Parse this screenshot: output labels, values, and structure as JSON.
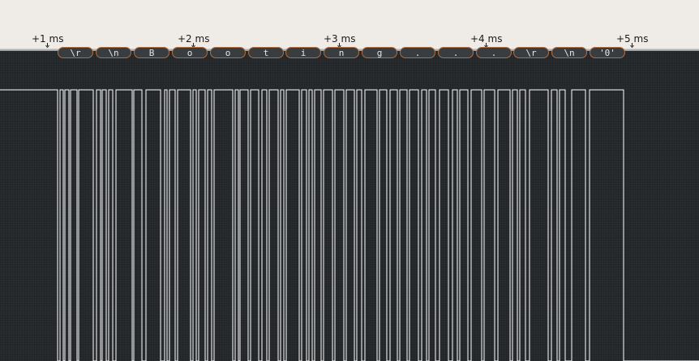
{
  "timeline": {
    "ticks": [
      {
        "label": "+1 ms"
      },
      {
        "label": "+2 ms"
      },
      {
        "label": "+3 ms"
      },
      {
        "label": "+4 ms"
      },
      {
        "label": "+5 ms"
      }
    ]
  },
  "decoder": {
    "accent_color": "#b06e42",
    "bubble_color": "#3a3d40",
    "text_color": "#e6e6e6",
    "frames": [
      "\\r",
      "\\n",
      "B",
      "o",
      "o",
      "t",
      "i",
      "n",
      "g",
      ".",
      ".",
      ".",
      "\\r",
      "\\n",
      "'0'"
    ]
  },
  "waveform": {
    "color": "#ffffff",
    "background": "#26292c"
  }
}
